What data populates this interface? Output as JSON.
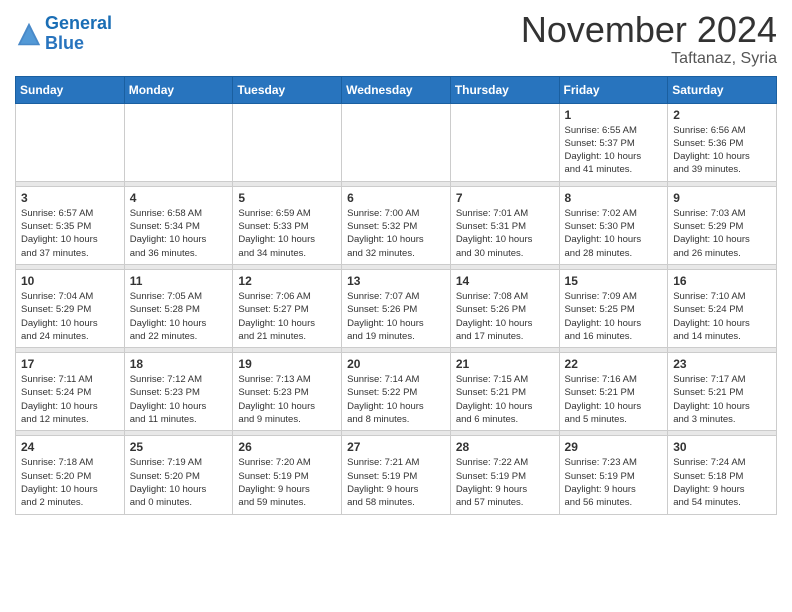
{
  "header": {
    "logo_line1": "General",
    "logo_line2": "Blue",
    "month": "November 2024",
    "location": "Taftanaz, Syria"
  },
  "weekdays": [
    "Sunday",
    "Monday",
    "Tuesday",
    "Wednesday",
    "Thursday",
    "Friday",
    "Saturday"
  ],
  "weeks": [
    [
      {
        "day": "",
        "info": ""
      },
      {
        "day": "",
        "info": ""
      },
      {
        "day": "",
        "info": ""
      },
      {
        "day": "",
        "info": ""
      },
      {
        "day": "",
        "info": ""
      },
      {
        "day": "1",
        "info": "Sunrise: 6:55 AM\nSunset: 5:37 PM\nDaylight: 10 hours\nand 41 minutes."
      },
      {
        "day": "2",
        "info": "Sunrise: 6:56 AM\nSunset: 5:36 PM\nDaylight: 10 hours\nand 39 minutes."
      }
    ],
    [
      {
        "day": "3",
        "info": "Sunrise: 6:57 AM\nSunset: 5:35 PM\nDaylight: 10 hours\nand 37 minutes."
      },
      {
        "day": "4",
        "info": "Sunrise: 6:58 AM\nSunset: 5:34 PM\nDaylight: 10 hours\nand 36 minutes."
      },
      {
        "day": "5",
        "info": "Sunrise: 6:59 AM\nSunset: 5:33 PM\nDaylight: 10 hours\nand 34 minutes."
      },
      {
        "day": "6",
        "info": "Sunrise: 7:00 AM\nSunset: 5:32 PM\nDaylight: 10 hours\nand 32 minutes."
      },
      {
        "day": "7",
        "info": "Sunrise: 7:01 AM\nSunset: 5:31 PM\nDaylight: 10 hours\nand 30 minutes."
      },
      {
        "day": "8",
        "info": "Sunrise: 7:02 AM\nSunset: 5:30 PM\nDaylight: 10 hours\nand 28 minutes."
      },
      {
        "day": "9",
        "info": "Sunrise: 7:03 AM\nSunset: 5:29 PM\nDaylight: 10 hours\nand 26 minutes."
      }
    ],
    [
      {
        "day": "10",
        "info": "Sunrise: 7:04 AM\nSunset: 5:29 PM\nDaylight: 10 hours\nand 24 minutes."
      },
      {
        "day": "11",
        "info": "Sunrise: 7:05 AM\nSunset: 5:28 PM\nDaylight: 10 hours\nand 22 minutes."
      },
      {
        "day": "12",
        "info": "Sunrise: 7:06 AM\nSunset: 5:27 PM\nDaylight: 10 hours\nand 21 minutes."
      },
      {
        "day": "13",
        "info": "Sunrise: 7:07 AM\nSunset: 5:26 PM\nDaylight: 10 hours\nand 19 minutes."
      },
      {
        "day": "14",
        "info": "Sunrise: 7:08 AM\nSunset: 5:26 PM\nDaylight: 10 hours\nand 17 minutes."
      },
      {
        "day": "15",
        "info": "Sunrise: 7:09 AM\nSunset: 5:25 PM\nDaylight: 10 hours\nand 16 minutes."
      },
      {
        "day": "16",
        "info": "Sunrise: 7:10 AM\nSunset: 5:24 PM\nDaylight: 10 hours\nand 14 minutes."
      }
    ],
    [
      {
        "day": "17",
        "info": "Sunrise: 7:11 AM\nSunset: 5:24 PM\nDaylight: 10 hours\nand 12 minutes."
      },
      {
        "day": "18",
        "info": "Sunrise: 7:12 AM\nSunset: 5:23 PM\nDaylight: 10 hours\nand 11 minutes."
      },
      {
        "day": "19",
        "info": "Sunrise: 7:13 AM\nSunset: 5:23 PM\nDaylight: 10 hours\nand 9 minutes."
      },
      {
        "day": "20",
        "info": "Sunrise: 7:14 AM\nSunset: 5:22 PM\nDaylight: 10 hours\nand 8 minutes."
      },
      {
        "day": "21",
        "info": "Sunrise: 7:15 AM\nSunset: 5:21 PM\nDaylight: 10 hours\nand 6 minutes."
      },
      {
        "day": "22",
        "info": "Sunrise: 7:16 AM\nSunset: 5:21 PM\nDaylight: 10 hours\nand 5 minutes."
      },
      {
        "day": "23",
        "info": "Sunrise: 7:17 AM\nSunset: 5:21 PM\nDaylight: 10 hours\nand 3 minutes."
      }
    ],
    [
      {
        "day": "24",
        "info": "Sunrise: 7:18 AM\nSunset: 5:20 PM\nDaylight: 10 hours\nand 2 minutes."
      },
      {
        "day": "25",
        "info": "Sunrise: 7:19 AM\nSunset: 5:20 PM\nDaylight: 10 hours\nand 0 minutes."
      },
      {
        "day": "26",
        "info": "Sunrise: 7:20 AM\nSunset: 5:19 PM\nDaylight: 9 hours\nand 59 minutes."
      },
      {
        "day": "27",
        "info": "Sunrise: 7:21 AM\nSunset: 5:19 PM\nDaylight: 9 hours\nand 58 minutes."
      },
      {
        "day": "28",
        "info": "Sunrise: 7:22 AM\nSunset: 5:19 PM\nDaylight: 9 hours\nand 57 minutes."
      },
      {
        "day": "29",
        "info": "Sunrise: 7:23 AM\nSunset: 5:19 PM\nDaylight: 9 hours\nand 56 minutes."
      },
      {
        "day": "30",
        "info": "Sunrise: 7:24 AM\nSunset: 5:18 PM\nDaylight: 9 hours\nand 54 minutes."
      }
    ]
  ]
}
